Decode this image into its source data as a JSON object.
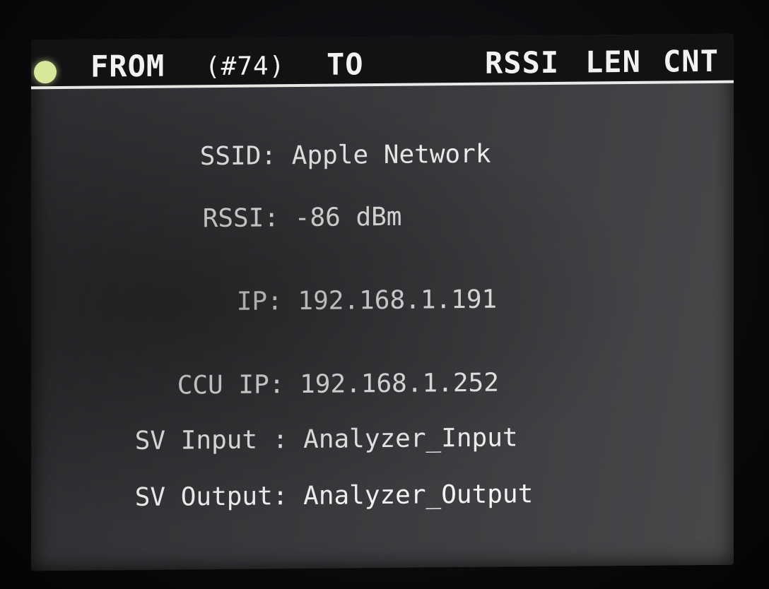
{
  "header": {
    "from_label": "FROM",
    "count_label": "(#74)",
    "to_label": "TO",
    "rssi_label": "RSSI",
    "len_label": "LEN",
    "cnt_label": "CNT",
    "status_color": "#d8e89a"
  },
  "info": {
    "ssid": {
      "label": "SSID:",
      "value": "Apple Network"
    },
    "rssi": {
      "label": "RSSI:",
      "value": "-86 dBm"
    },
    "ip": {
      "label": "IP:",
      "value": "192.168.1.191"
    },
    "ccu_ip": {
      "label": "CCU IP:",
      "value": "192.168.1.252"
    },
    "sv_input": {
      "label": "SV Input :",
      "value": "Analyzer_Input"
    },
    "sv_output": {
      "label": "SV Output:",
      "value": "Analyzer_Output"
    }
  }
}
